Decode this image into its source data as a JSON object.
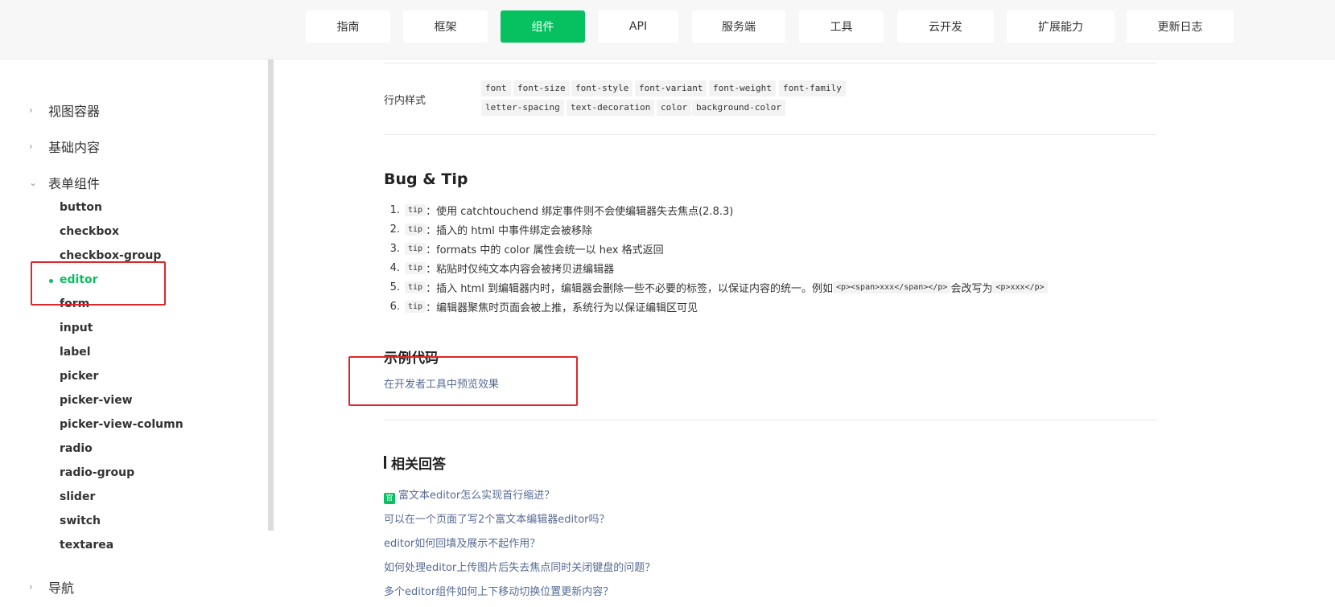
{
  "nav": [
    {
      "label": "指南"
    },
    {
      "label": "框架"
    },
    {
      "label": "组件",
      "active": true
    },
    {
      "label": "API"
    },
    {
      "label": "服务端"
    },
    {
      "label": "工具"
    },
    {
      "label": "云开发"
    },
    {
      "label": "扩展能力"
    },
    {
      "label": "更新日志"
    }
  ],
  "sidebar": {
    "cat_view": "视图容器",
    "cat_basic": "基础内容",
    "cat_form": "表单组件",
    "cat_nav": "导航",
    "items": [
      "button",
      "checkbox",
      "checkbox-group",
      "editor",
      "form",
      "input",
      "label",
      "picker",
      "picker-view",
      "picker-view-column",
      "radio",
      "radio-group",
      "slider",
      "switch",
      "textarea"
    ],
    "active_item": "editor"
  },
  "styles_row": {
    "label": "行内样式",
    "line1": [
      "font",
      "font-size",
      "font-style",
      "font-variant",
      "font-weight",
      "font-family"
    ],
    "line2": [
      "letter-spacing",
      "text-decoration",
      "color",
      "background-color"
    ]
  },
  "bug_tip": {
    "title": "Bug & Tip",
    "tips": [
      {
        "n": "1.",
        "tag": "tip",
        "text": "：使用 catchtouchend 绑定事件则不会使编辑器失去焦点(2.8.3)"
      },
      {
        "n": "2.",
        "tag": "tip",
        "text": "：插入的 html 中事件绑定会被移除"
      },
      {
        "n": "3.",
        "tag": "tip",
        "text": "：formats 中的 color 属性会统一以 hex 格式返回"
      },
      {
        "n": "4.",
        "tag": "tip",
        "text": "：粘贴时仅纯文本内容会被拷贝进编辑器"
      },
      {
        "n": "5.",
        "tag": "tip",
        "text": "：插入 html 到编辑器内时，编辑器会删除一些不必要的标签，以保证内容的统一。例如 ",
        "code1": "<p><span>xxx</span></p>",
        "mid": " 会改写为 ",
        "code2": "<p>xxx</p>"
      },
      {
        "n": "6.",
        "tag": "tip",
        "text": "：编辑器聚焦时页面会被上推，系统行为以保证编辑区可见"
      }
    ]
  },
  "example": {
    "title": "示例代码",
    "link": "在开发者工具中预览效果"
  },
  "related": {
    "title": "相关回答",
    "official_badge": "官",
    "links": [
      "富文本editor怎么实现首行缩进？",
      "可以在一个页面了写2个富文本编辑器editor吗？",
      "editor如何回填及展示不起作用？",
      "如何处理editor上传图片后失去焦点同时关闭键盘的问题？",
      "多个editor组件如何上下移动切换位置更新内容？"
    ]
  },
  "colors": {
    "accent": "#07c160",
    "link": "#576b95",
    "highlight": "#e0262a"
  }
}
